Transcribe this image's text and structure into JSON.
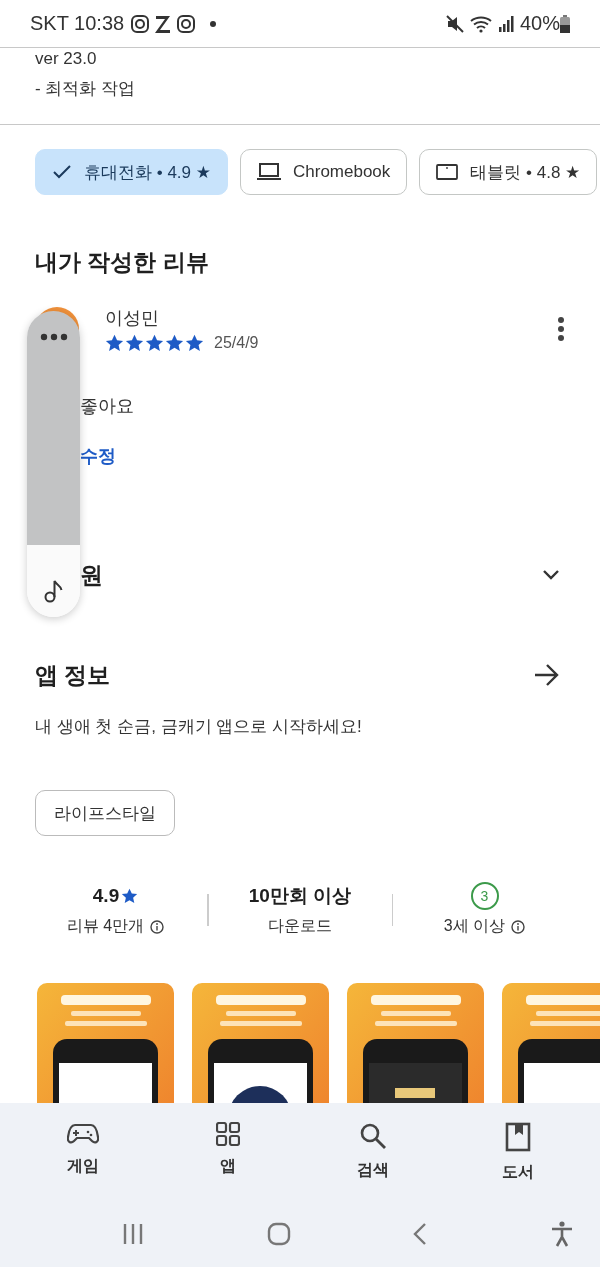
{
  "status_bar": {
    "carrier": "SKT",
    "time": "10:38",
    "battery": "40%"
  },
  "whats_new": {
    "lines": [
      "ver 23.0",
      "- 최적화 작업"
    ]
  },
  "device_chips": [
    {
      "label": "휴대전화 • 4.9 ★",
      "selected": true
    },
    {
      "label": "Chromebook",
      "selected": false,
      "kind": "laptop"
    },
    {
      "label": "태블릿 • 4.8 ★",
      "selected": false,
      "kind": "tablet"
    }
  ],
  "my_review": {
    "title": "내가 작성한 리뷰",
    "author": "이성민",
    "stars": 5,
    "date": "25/4/9",
    "text": "좋아요",
    "edit_link": "수정"
  },
  "support": {
    "title": "원"
  },
  "app_info": {
    "title": "앱 정보",
    "description": "내 생애 첫 순금, 금캐기 앱으로 시작하세요!",
    "category": "라이프스타일"
  },
  "stats": [
    {
      "kind": "rating",
      "value": "4.9",
      "label": "리뷰 4만개"
    },
    {
      "kind": "downloads",
      "value": "10만회 이상",
      "label": "다운로드"
    },
    {
      "kind": "age",
      "value": "3",
      "label": "3세 이상"
    }
  ],
  "bottom_nav": [
    {
      "kind": "games",
      "label": "게임"
    },
    {
      "kind": "apps",
      "label": "앱"
    },
    {
      "kind": "search",
      "label": "검색"
    },
    {
      "kind": "books",
      "label": "도서"
    }
  ]
}
